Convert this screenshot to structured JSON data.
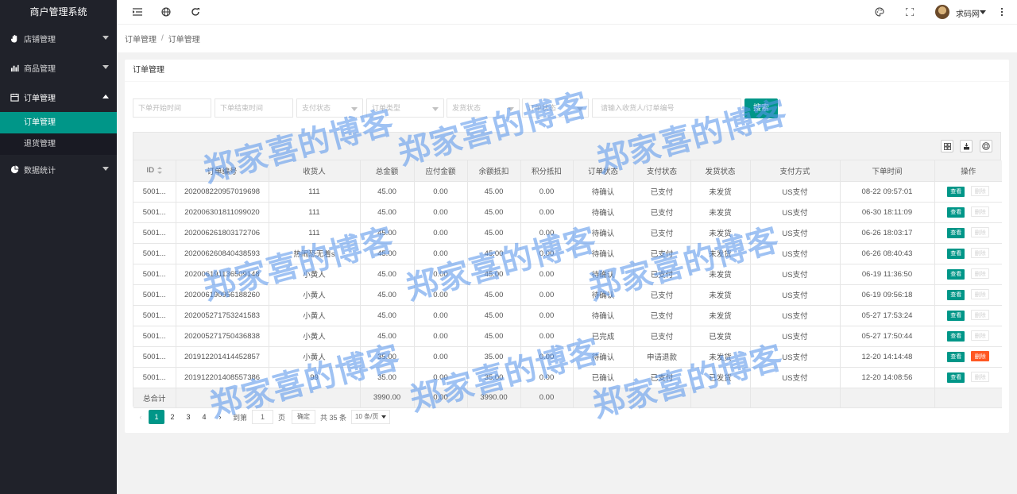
{
  "app": {
    "title": "商户管理系统"
  },
  "sidebar": {
    "items": [
      {
        "label": "店铺管理",
        "icon": "hand-icon"
      },
      {
        "label": "商品管理",
        "icon": "bar-chart-icon"
      },
      {
        "label": "订单管理",
        "icon": "calendar-icon",
        "children": [
          {
            "label": "订单管理",
            "active": true
          },
          {
            "label": "退货管理"
          }
        ]
      },
      {
        "label": "数据统计",
        "icon": "pie-chart-icon"
      }
    ]
  },
  "header": {
    "username": "求码网"
  },
  "breadcrumb": {
    "items": [
      "订单管理",
      "订单管理"
    ],
    "separator": "/"
  },
  "card": {
    "title": "订单管理"
  },
  "filters": {
    "start_time_placeholder": "下单开始时间",
    "end_time_placeholder": "下单结束时间",
    "pay_status_placeholder": "支付状态",
    "type_placeholder": "订单类型",
    "ship_status_placeholder": "发货状态",
    "order_status_placeholder": "订单状态",
    "keyword_placeholder": "请输入收货人/订单编号",
    "search_label": "搜索"
  },
  "table": {
    "columns": [
      "ID",
      "订单编号",
      "收货人",
      "总金额",
      "应付金额",
      "余额抵扣",
      "积分抵扣",
      "订单状态",
      "支付状态",
      "发货状态",
      "支付方式",
      "下单时间",
      "操作"
    ],
    "view_label": "查看",
    "delete_label": "删除",
    "rows": [
      [
        "5001...",
        "202008220957019698",
        "111",
        "45.00",
        "0.00",
        "45.00",
        "0.00",
        "待确认",
        "已支付",
        "未发货",
        "US支付",
        "08-22 09:57:01"
      ],
      [
        "5001...",
        "202006301811099020",
        "111",
        "45.00",
        "0.00",
        "45.00",
        "0.00",
        "待确认",
        "已支付",
        "未发货",
        "US支付",
        "06-30 18:11:09"
      ],
      [
        "5001...",
        "202006261803172706",
        "111",
        "45.00",
        "0.00",
        "45.00",
        "0.00",
        "待确认",
        "已支付",
        "未发货",
        "US支付",
        "06-26 18:03:17"
      ],
      [
        "5001...",
        "202006260840438593",
        "热闹恐无着s",
        "45.00",
        "0.00",
        "45.00",
        "0.00",
        "待确认",
        "已支付",
        "未发货",
        "US支付",
        "06-26 08:40:43"
      ],
      [
        "5001...",
        "202006191136509148",
        "小黄人",
        "45.00",
        "0.00",
        "45.00",
        "0.00",
        "待确认",
        "已支付",
        "未发货",
        "US支付",
        "06-19 11:36:50"
      ],
      [
        "5001...",
        "202006190956188260",
        "小黄人",
        "45.00",
        "0.00",
        "45.00",
        "0.00",
        "待确认",
        "已支付",
        "未发货",
        "US支付",
        "06-19 09:56:18"
      ],
      [
        "5001...",
        "202005271753241583",
        "小黄人",
        "45.00",
        "0.00",
        "45.00",
        "0.00",
        "待确认",
        "已支付",
        "未发货",
        "US支付",
        "05-27 17:53:24"
      ],
      [
        "5001...",
        "202005271750436838",
        "小黄人",
        "45.00",
        "0.00",
        "45.00",
        "0.00",
        "已完成",
        "已支付",
        "已发货",
        "US支付",
        "05-27 17:50:44"
      ],
      [
        "5001...",
        "201912201414452857",
        "小黄人",
        "35.00",
        "0.00",
        "35.00",
        "0.00",
        "待确认",
        "申请退款",
        "未发货",
        "US支付",
        "12-20 14:14:48"
      ],
      [
        "5001...",
        "201912201408557386",
        "99",
        "35.00",
        "0.00",
        "35.00",
        "0.00",
        "已确认",
        "已支付",
        "已发货",
        "US支付",
        "12-20 14:08:56"
      ]
    ],
    "delete_active_row": 8,
    "totals": {
      "label": "总合计",
      "total_amount": "3990.00",
      "payable": "0.00",
      "balance": "3990.00",
      "points": "0.00"
    }
  },
  "pagination": {
    "pages": [
      "1",
      "2",
      "3",
      "4"
    ],
    "current": "1",
    "goto_label": "到第",
    "goto_value": "1",
    "page_unit": "页",
    "confirm_label": "确定",
    "total_text": "共 35 条",
    "page_size": "10 条/页"
  },
  "watermark": {
    "text": "郑家喜的博客"
  }
}
